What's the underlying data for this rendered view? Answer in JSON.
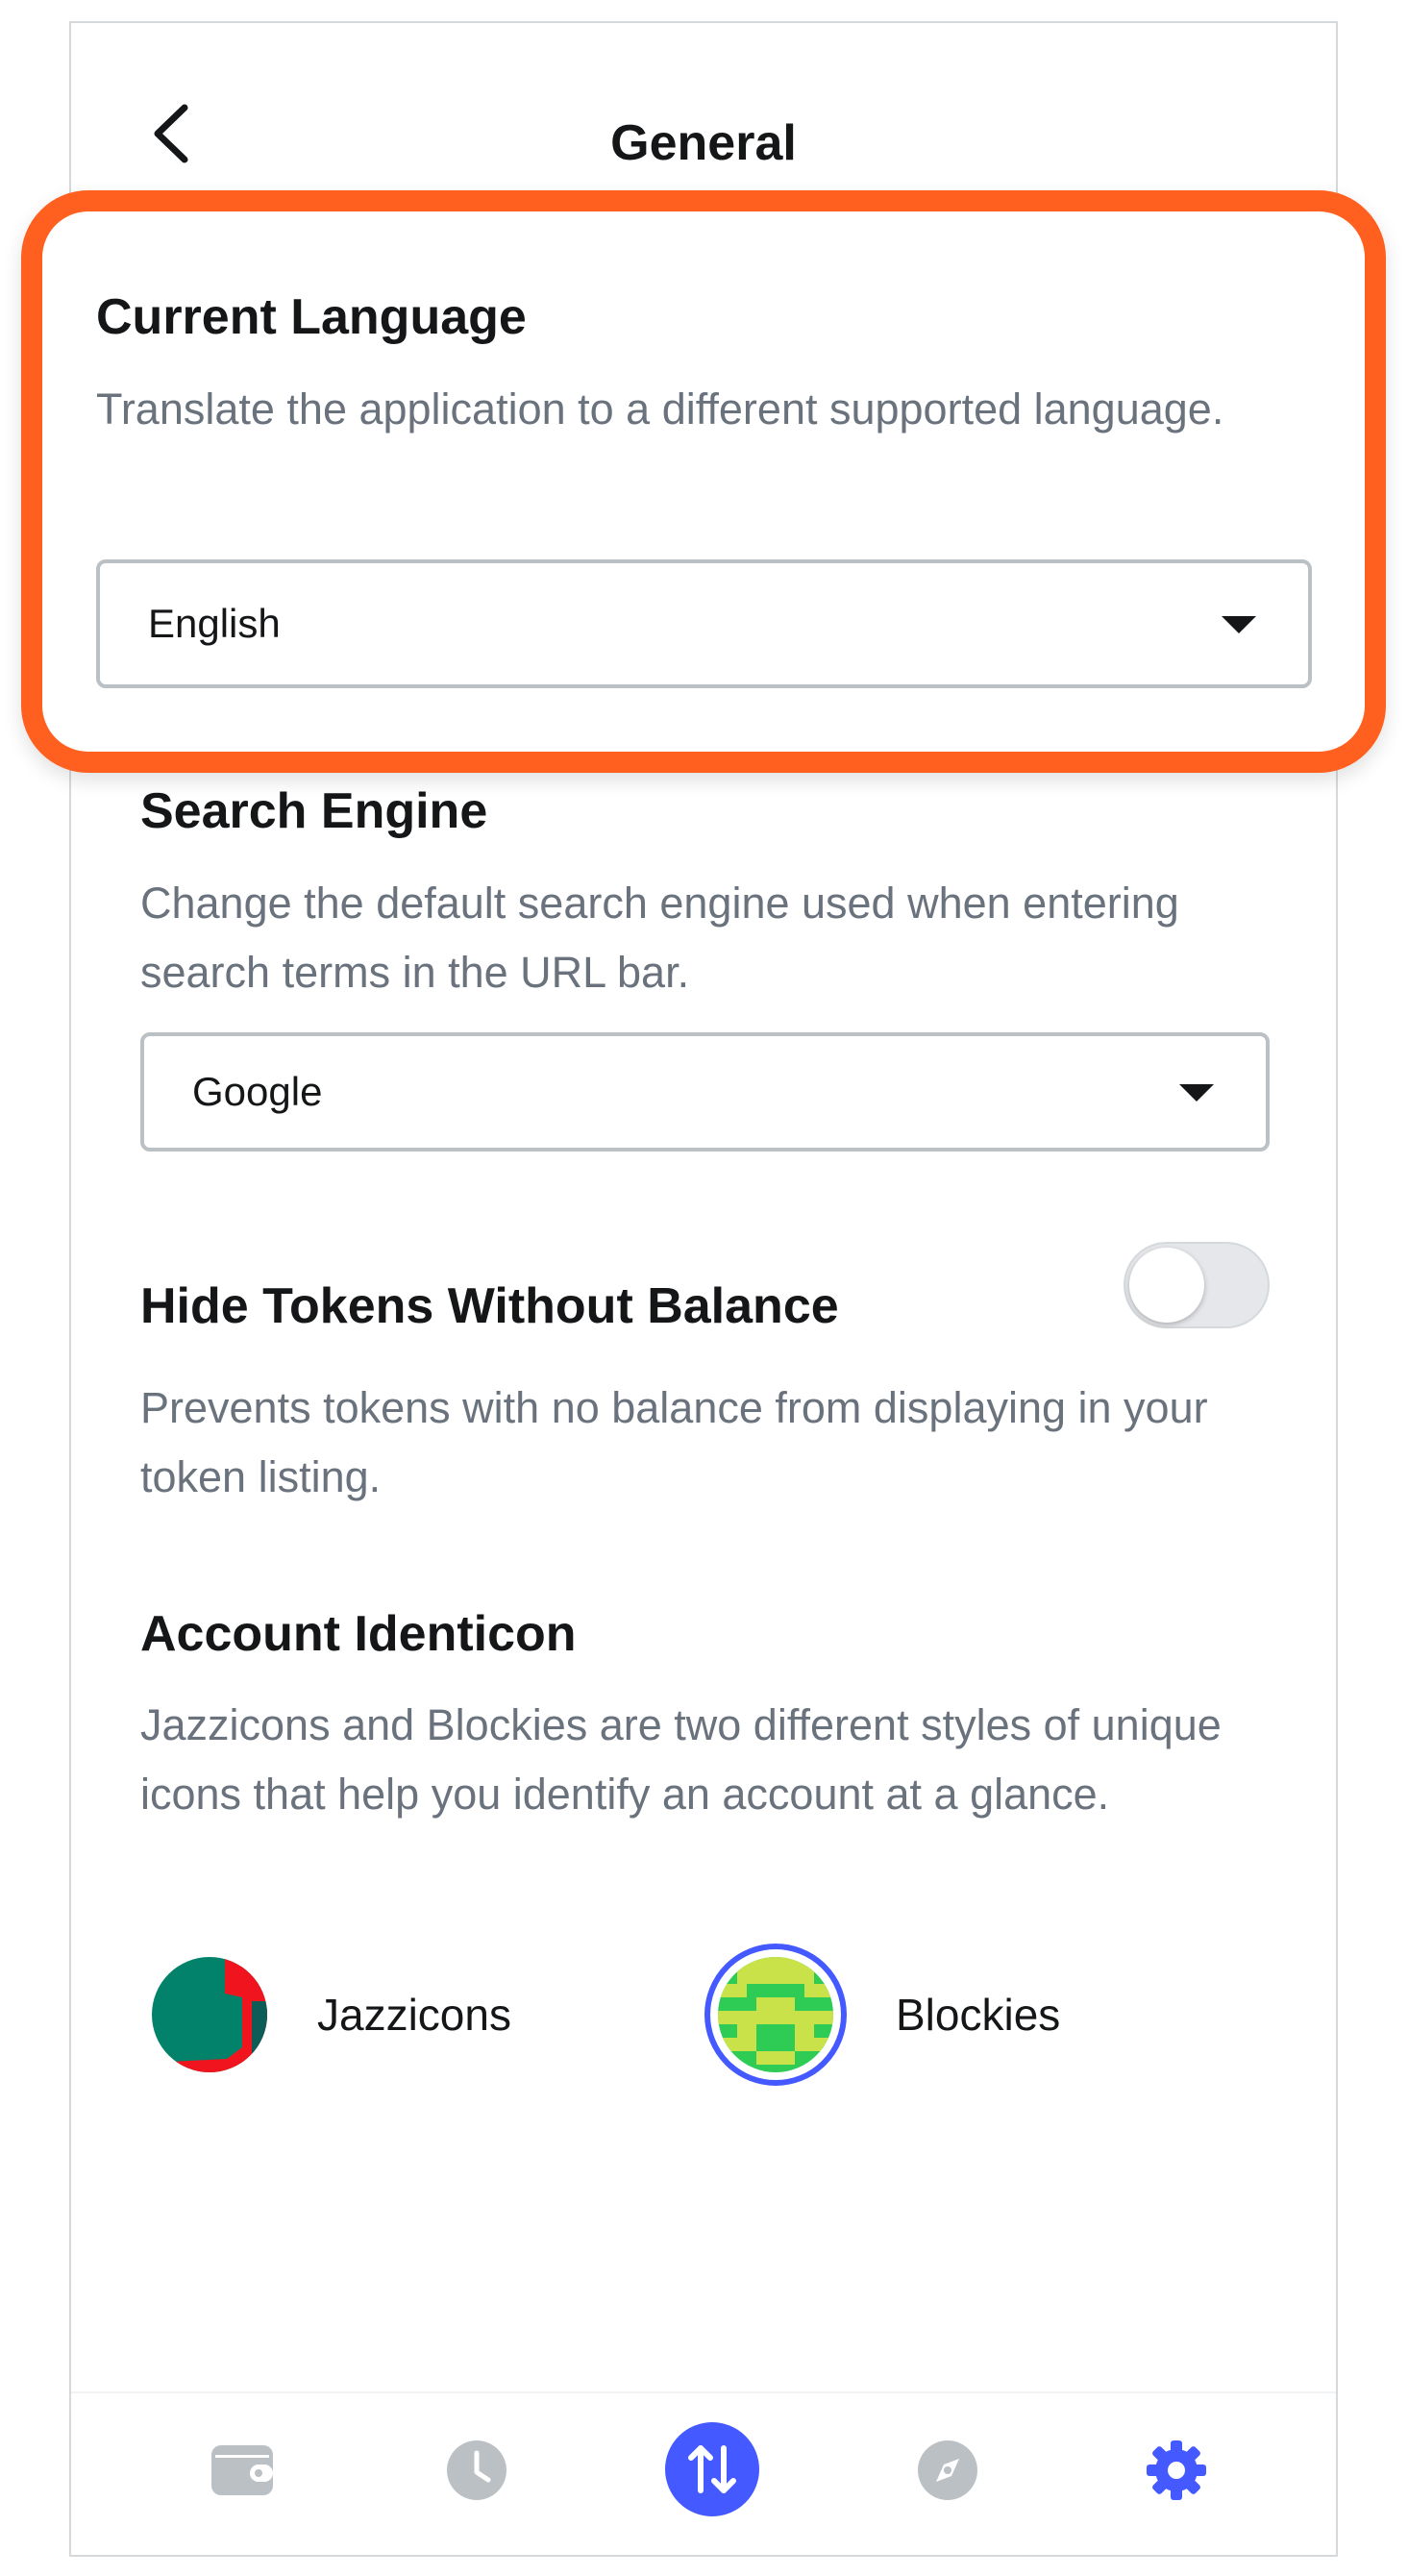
{
  "header": {
    "title": "General"
  },
  "current_language": {
    "title": "Current Language",
    "description": "Translate the application to a different supported language.",
    "selected": "English"
  },
  "search_engine": {
    "title": "Search Engine",
    "description": "Change the default search engine used when entering search terms in the URL bar.",
    "selected": "Google"
  },
  "hide_tokens": {
    "title": "Hide Tokens Without Balance",
    "description": "Prevents tokens with no balance from displaying in your token listing.",
    "enabled": false
  },
  "account_identicon": {
    "title": "Account Identicon",
    "description": "Jazzicons and Blockies are two different styles of unique icons that help you identify an account at a glance.",
    "options": [
      {
        "label": "Jazzicons",
        "selected": false
      },
      {
        "label": "Blockies",
        "selected": true
      }
    ]
  },
  "colors": {
    "accent": "#4459ff",
    "highlight": "#ff5f1f",
    "muted_icon": "#bbc0c5"
  },
  "bottom_nav": [
    {
      "icon": "wallet-icon"
    },
    {
      "icon": "clock-icon"
    },
    {
      "icon": "swap-arrows-icon"
    },
    {
      "icon": "compass-icon"
    },
    {
      "icon": "gear-icon"
    }
  ]
}
